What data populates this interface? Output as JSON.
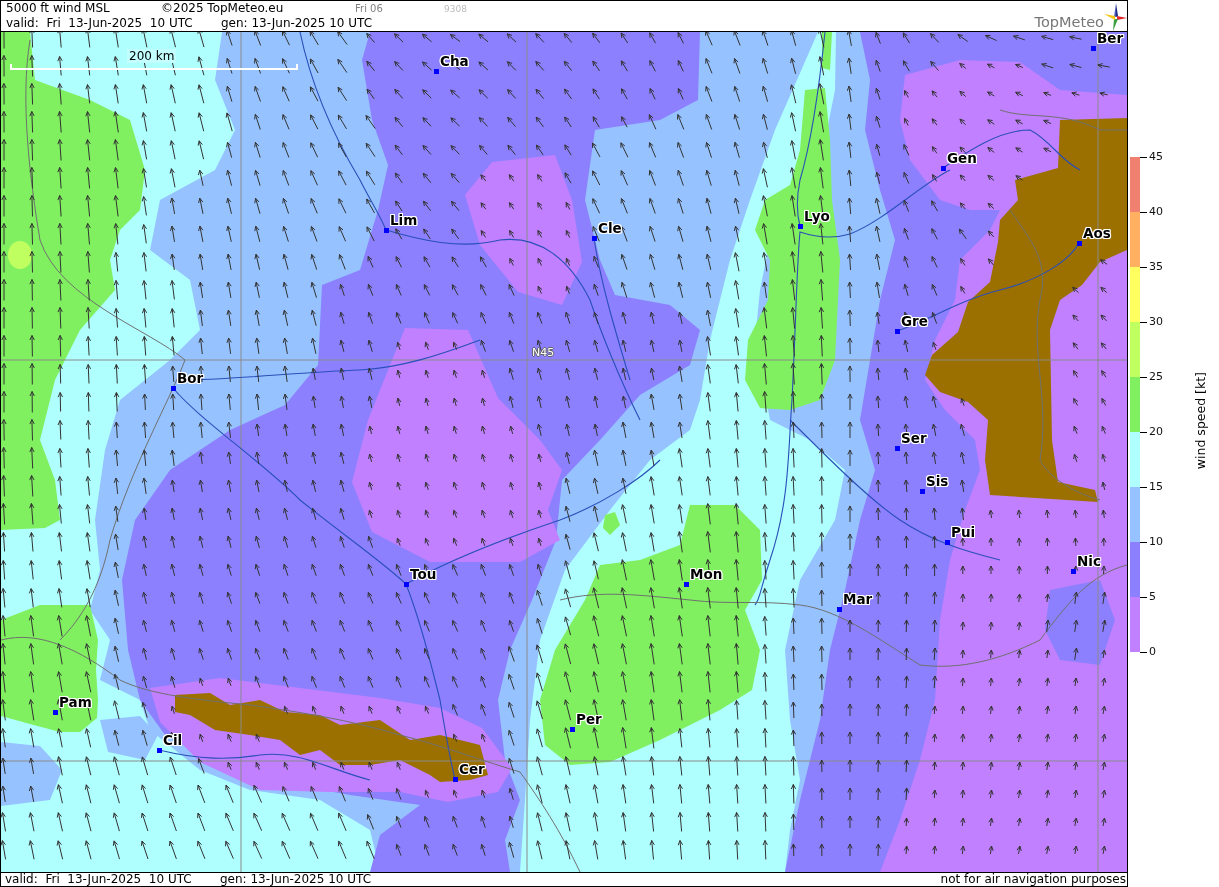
{
  "header": {
    "title": "5000 ft wind MSL",
    "copyright": "©2025 TopMeteo.eu",
    "run": "Fri 06",
    "code": "9308",
    "valid": "valid:  Fri  13-Jun-2025  10 UTC",
    "generated": "gen: 13-Jun-2025 10 UTC",
    "logo": "TopMeteo"
  },
  "map": {
    "scale_bar": "200 km",
    "grid_label": "N45",
    "cities": [
      {
        "label": "Ber"
      },
      {
        "label": "Cha"
      },
      {
        "label": "Gen"
      },
      {
        "label": "Lyo"
      },
      {
        "label": "Lim"
      },
      {
        "label": "Cle"
      },
      {
        "label": "Aos"
      },
      {
        "label": "Gre"
      },
      {
        "label": "Bor"
      },
      {
        "label": "Ser"
      },
      {
        "label": "Sis"
      },
      {
        "label": "Pui"
      },
      {
        "label": "Nic"
      },
      {
        "label": "Tou"
      },
      {
        "label": "Mon"
      },
      {
        "label": "Mar"
      },
      {
        "label": "Pam"
      },
      {
        "label": "Per"
      },
      {
        "label": "Cil"
      },
      {
        "label": "Cer"
      }
    ]
  },
  "legend": {
    "title": "wind speed [kt]",
    "bands": [
      {
        "color": "#f08070"
      },
      {
        "color": "#ffb060"
      },
      {
        "color": "#ffff60"
      },
      {
        "color": "#c0ff60"
      },
      {
        "color": "#80f060"
      },
      {
        "color": "#b0ffff"
      },
      {
        "color": "#96c3ff"
      },
      {
        "color": "#8c80ff"
      },
      {
        "color": "#c080ff"
      }
    ],
    "ticks": [
      "45",
      "40",
      "35",
      "30",
      "25",
      "20",
      "15",
      "10",
      "5",
      "0"
    ]
  },
  "footer": {
    "valid": "valid:  Fri  13-Jun-2025  10 UTC",
    "generated": "gen: 13-Jun-2025 10 UTC",
    "disclaimer": "not for air navigation purposes"
  }
}
